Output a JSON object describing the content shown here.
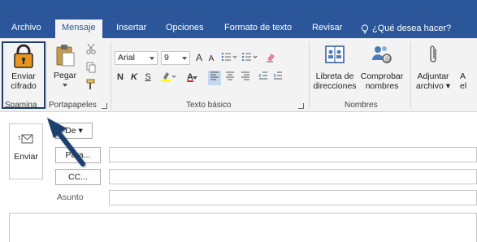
{
  "tabs": [
    {
      "label": "Archivo"
    },
    {
      "label": "Mensaje"
    },
    {
      "label": "Insertar"
    },
    {
      "label": "Opciones"
    },
    {
      "label": "Formato de texto"
    },
    {
      "label": "Revisar"
    }
  ],
  "tell_me": {
    "label": "¿Qué desea hacer?",
    "icon": "lightbulb-icon"
  },
  "ribbon": {
    "spamina": {
      "button_label_line1": "Enviar",
      "button_label_line2": "cifrado",
      "group_label": "Spamina",
      "icon": "padlock-icon"
    },
    "clipboard": {
      "paste_label": "Pegar",
      "group_label": "Portapapeles"
    },
    "basic_text": {
      "font_name": "Arial",
      "font_size": "9",
      "bold": "N",
      "italic": "K",
      "underline": "S",
      "grow_font": "A",
      "shrink_font": "A",
      "font_color": "A",
      "group_label": "Texto básico"
    },
    "names": {
      "address_book_line1": "Libreta de",
      "address_book_line2": "direcciones",
      "check_names_line1": "Comprobar",
      "check_names_line2": "nombres",
      "group_label": "Nombres"
    },
    "include": {
      "attach_line1": "Adjuntar",
      "attach_line2": "archivo",
      "partial_line1": "A",
      "partial_line2": "el"
    }
  },
  "compose": {
    "send_label": "Enviar",
    "from_label": "De",
    "to_label": "Para...",
    "cc_label": "CC...",
    "subject_label": "Asunto"
  },
  "colors": {
    "tab_bar": "#2b579a",
    "ribbon": "#f3f3f3",
    "highlight_border": "#1d3c66",
    "arrow": "#1f3f6e"
  }
}
